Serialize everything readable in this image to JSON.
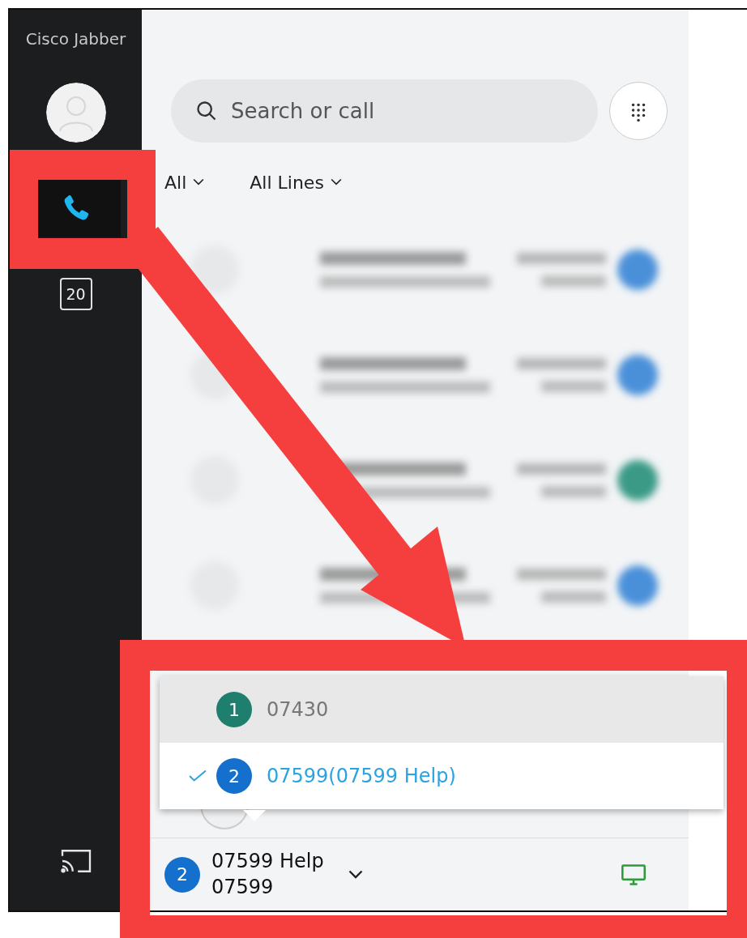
{
  "app": {
    "title": "Cisco Jabber"
  },
  "sidebar": {
    "items": [
      {
        "kind": "phone",
        "selected": true
      },
      {
        "kind": "calendar",
        "label": "20",
        "selected": false
      }
    ]
  },
  "search": {
    "placeholder": "Search or call"
  },
  "filters": [
    {
      "label": "All"
    },
    {
      "label": "All Lines"
    }
  ],
  "recent_calls": [
    {
      "color": "#4a90d9"
    },
    {
      "color": "#4a90d9"
    },
    {
      "color": "#3a9a86"
    },
    {
      "color": "#4a90d9"
    }
  ],
  "line_menu": {
    "items": [
      {
        "number": "1",
        "label": "07430",
        "color": "#1e7f6e",
        "selected": false
      },
      {
        "number": "2",
        "label": "07599(07599 Help)",
        "color": "#1470cc",
        "selected": true
      }
    ]
  },
  "current_line": {
    "number": "2",
    "color": "#1470cc",
    "name": "07599 Help",
    "line": "07599"
  }
}
